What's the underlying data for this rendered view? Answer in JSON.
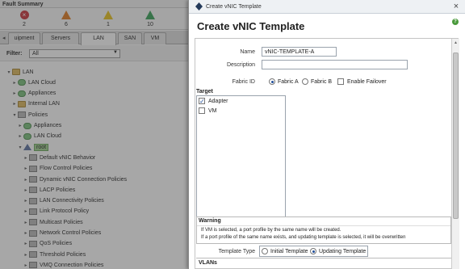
{
  "fault_summary": {
    "title": "Fault Summary",
    "counts": [
      {
        "icon": "critical-x-icon",
        "value": "2",
        "color": "#c8323a"
      },
      {
        "icon": "major-triangle-icon",
        "value": "6",
        "color": "#e07a1f"
      },
      {
        "icon": "minor-triangle-icon",
        "value": "1",
        "color": "#e8c21a"
      },
      {
        "icon": "warning-triangle-icon",
        "value": "10",
        "color": "#36a157"
      }
    ]
  },
  "nav_tabs": {
    "items": [
      {
        "label": "uipment"
      },
      {
        "label": "Servers"
      },
      {
        "label": "LAN"
      },
      {
        "label": "SAN"
      },
      {
        "label": "VM"
      }
    ],
    "active": "LAN"
  },
  "filter": {
    "label": "Filter:",
    "value": "All"
  },
  "tree": [
    {
      "label": "LAN",
      "indent": 0,
      "icon": "folder"
    },
    {
      "label": "LAN Cloud",
      "indent": 1,
      "icon": "cloud"
    },
    {
      "label": "Appliances",
      "indent": 1,
      "icon": "cloud"
    },
    {
      "label": "Internal LAN",
      "indent": 1,
      "icon": "folder"
    },
    {
      "label": "Policies",
      "indent": 1,
      "icon": "policy"
    },
    {
      "label": "Appliances",
      "indent": 2,
      "icon": "cloud"
    },
    {
      "label": "LAN Cloud",
      "indent": 2,
      "icon": "cloud"
    },
    {
      "label": "root",
      "indent": 2,
      "icon": "root",
      "selected": true
    },
    {
      "label": "Default vNIC Behavior",
      "indent": 3,
      "icon": "policy"
    },
    {
      "label": "Flow Control Policies",
      "indent": 3,
      "icon": "policy"
    },
    {
      "label": "Dynamic vNIC Connection Policies",
      "indent": 3,
      "icon": "policy"
    },
    {
      "label": "LACP Policies",
      "indent": 3,
      "icon": "policy"
    },
    {
      "label": "LAN Connectivity Policies",
      "indent": 3,
      "icon": "policy"
    },
    {
      "label": "Link Protocol Policy",
      "indent": 3,
      "icon": "policy"
    },
    {
      "label": "Multicast Policies",
      "indent": 3,
      "icon": "policy"
    },
    {
      "label": "Network Control Policies",
      "indent": 3,
      "icon": "policy"
    },
    {
      "label": "QoS Policies",
      "indent": 3,
      "icon": "policy"
    },
    {
      "label": "Threshold Policies",
      "indent": 3,
      "icon": "policy"
    },
    {
      "label": "VMQ Connection Policies",
      "indent": 3,
      "icon": "policy"
    }
  ],
  "modal": {
    "window_title": "Create vNIC Template",
    "heading": "Create vNIC Template",
    "help_icon": "?",
    "close_icon": "×",
    "form": {
      "name_label": "Name",
      "name_value": "vNIC-TEMPLATE-A",
      "description_label": "Description",
      "description_value": "",
      "fabric_label": "Fabric ID",
      "fabric_options": [
        "Fabric A",
        "Fabric B"
      ],
      "fabric_selected": "Fabric A",
      "failover_label": "Enable Failover",
      "failover_checked": false,
      "target_label": "Target",
      "target_options": [
        {
          "label": "Adapter",
          "checked": true
        },
        {
          "label": "VM",
          "checked": false
        }
      ],
      "warning_title": "Warning",
      "warning_lines": [
        "If VM is selected, a port profile by the same name will be created.",
        "If a port profile of the same name exists, and updating template is selected, it will be overwritten"
      ],
      "template_type_label": "Template Type",
      "template_type_options": [
        "Initial Template",
        "Updating Template"
      ],
      "template_type_selected": "Updating Template",
      "vlans_label": "VLANs"
    }
  }
}
